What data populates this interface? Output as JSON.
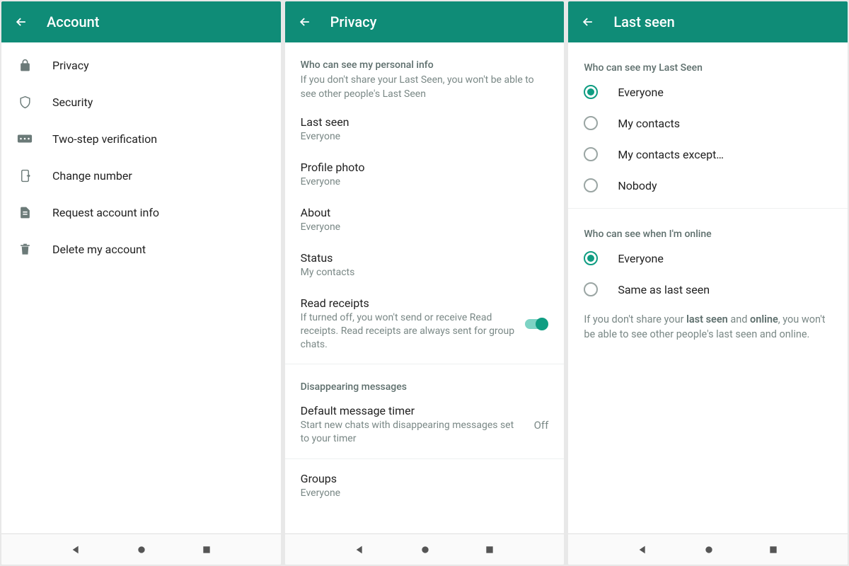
{
  "panel1": {
    "title": "Account",
    "items": [
      {
        "label": "Privacy"
      },
      {
        "label": "Security"
      },
      {
        "label": "Two-step verification"
      },
      {
        "label": "Change number"
      },
      {
        "label": "Request account info"
      },
      {
        "label": "Delete my account"
      }
    ]
  },
  "panel2": {
    "title": "Privacy",
    "section1_header": "Who can see my personal info",
    "section1_sub": "If you don't share your Last Seen, you won't be able to see other people's Last Seen",
    "last_seen": {
      "title": "Last seen",
      "value": "Everyone"
    },
    "profile_photo": {
      "title": "Profile photo",
      "value": "Everyone"
    },
    "about": {
      "title": "About",
      "value": "Everyone"
    },
    "status": {
      "title": "Status",
      "value": "My contacts"
    },
    "read_receipts": {
      "title": "Read receipts",
      "sub": "If turned off, you won't send or receive Read receipts. Read receipts are always sent for group chats."
    },
    "section2_header": "Disappearing messages",
    "default_timer": {
      "title": "Default message timer",
      "sub": "Start new chats with disappearing messages set to your timer",
      "value": "Off"
    },
    "groups": {
      "title": "Groups",
      "value": "Everyone"
    }
  },
  "panel3": {
    "title": "Last seen",
    "section1_header": "Who can see my Last Seen",
    "opts1": [
      {
        "label": "Everyone",
        "selected": true
      },
      {
        "label": "My contacts",
        "selected": false
      },
      {
        "label": "My contacts except…",
        "selected": false
      },
      {
        "label": "Nobody",
        "selected": false
      }
    ],
    "section2_header": "Who can see when I'm online",
    "opts2": [
      {
        "label": "Everyone",
        "selected": true
      },
      {
        "label": "Same as last seen",
        "selected": false
      }
    ],
    "info_prefix": "If you don't share your ",
    "info_b1": "last seen",
    "info_mid": " and ",
    "info_b2": "online",
    "info_suffix": ", you won't be able to see other people's last seen and online."
  }
}
